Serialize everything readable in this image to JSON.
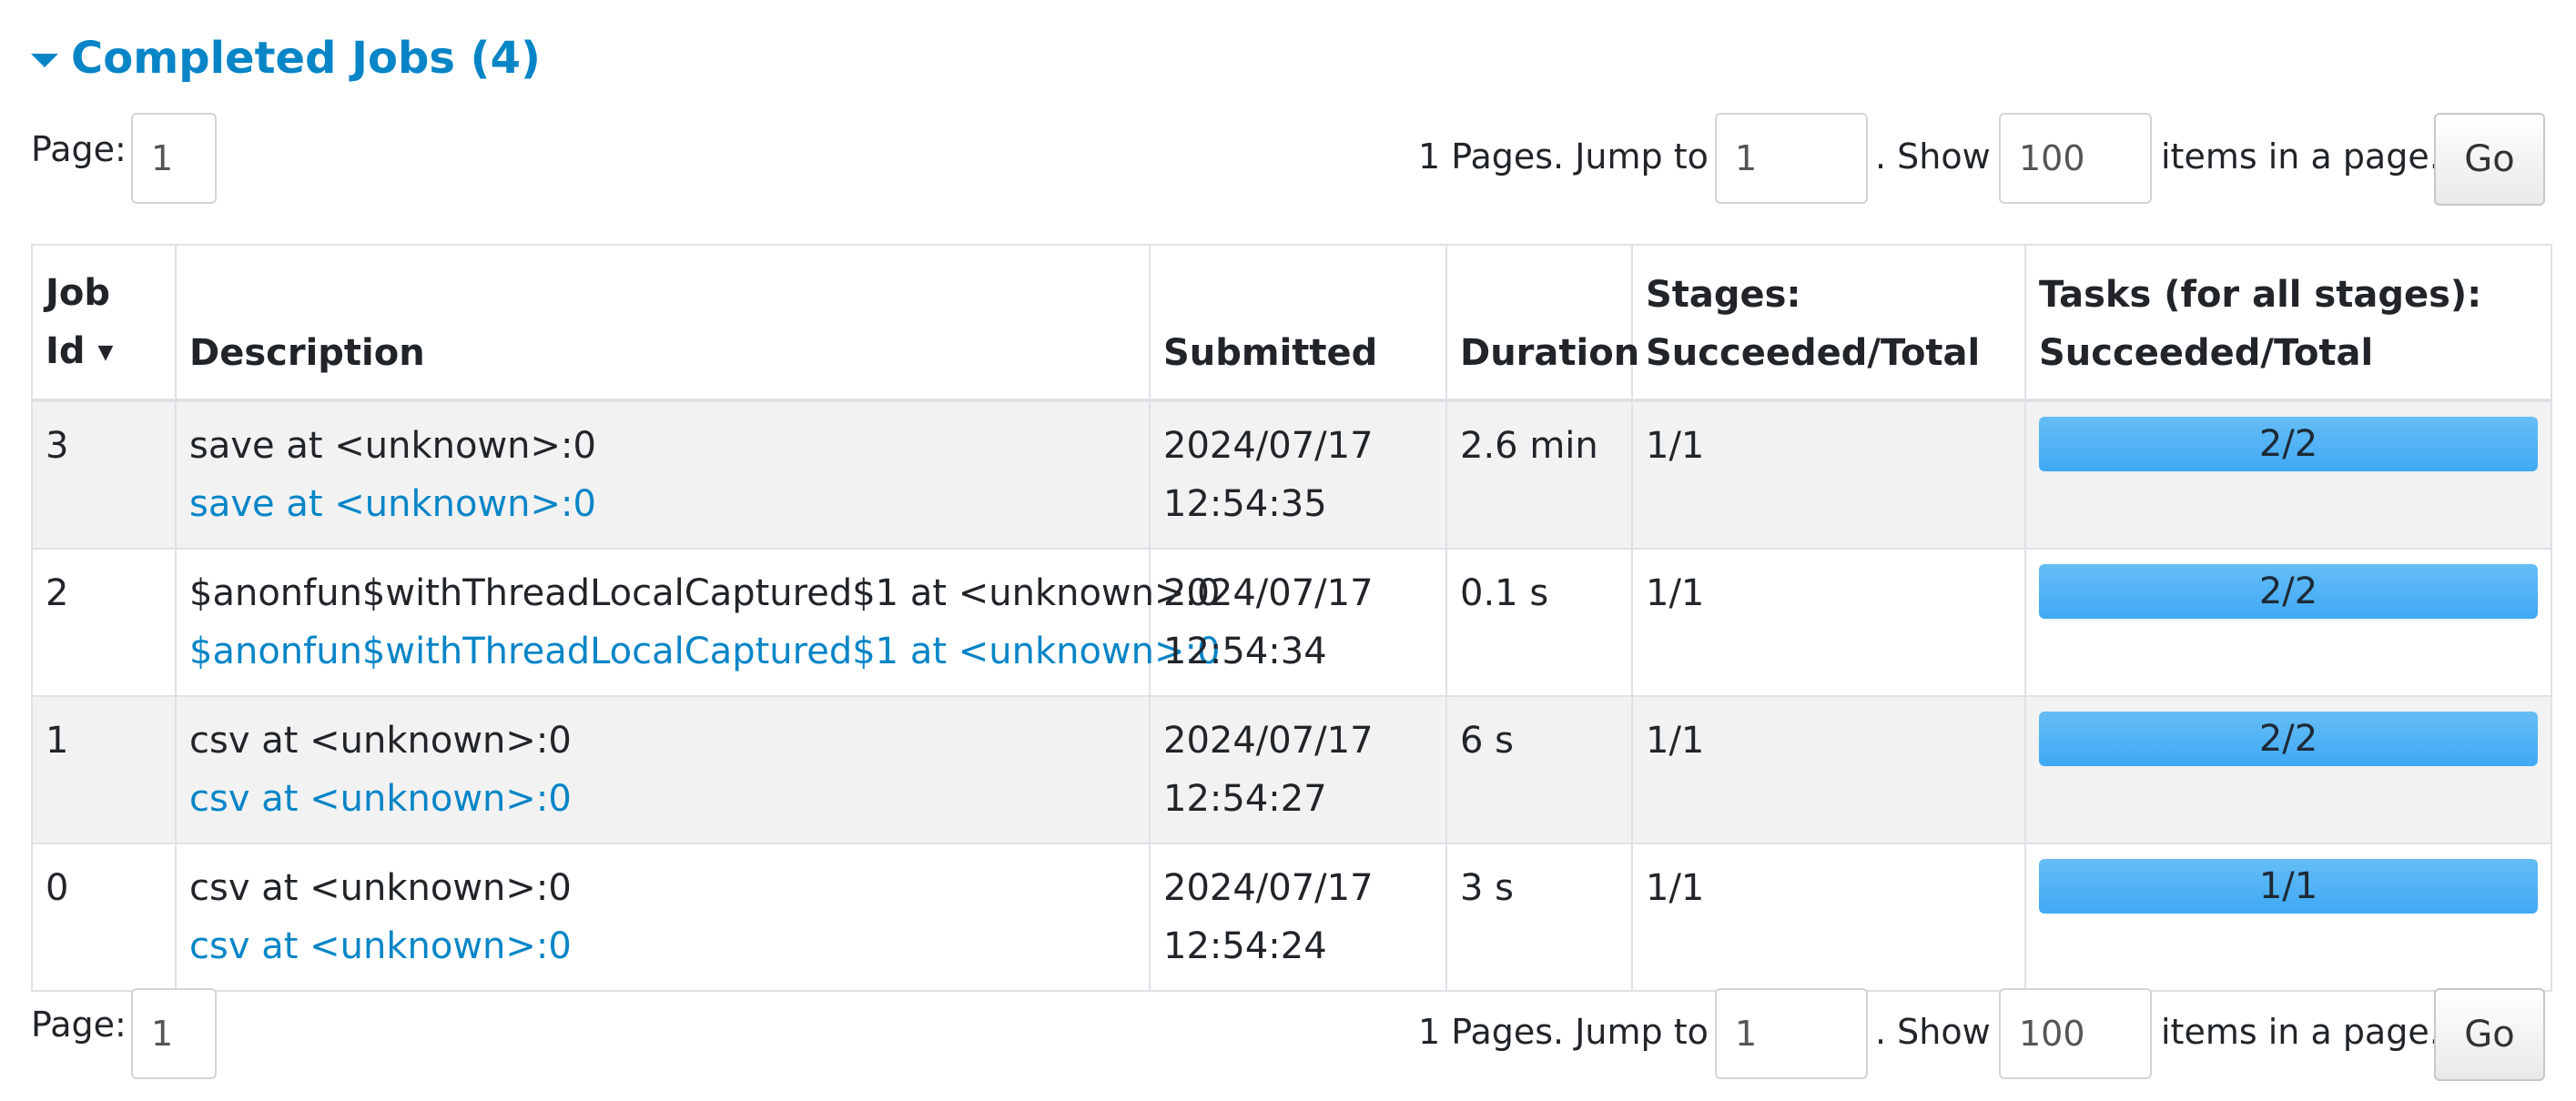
{
  "section": {
    "title": "Completed Jobs (4)"
  },
  "pagination": {
    "page_label": "Page:",
    "page_value": "1",
    "pages_text": "1 Pages. Jump to",
    "jump_value": "1",
    "show_text": ". Show",
    "show_value": "100",
    "items_text": "items in a page.",
    "go_label": "Go"
  },
  "table": {
    "headers": {
      "job_id_1": "Job",
      "job_id_2": "Id",
      "sort_icon": "▼",
      "description": "Description",
      "submitted": "Submitted",
      "duration": "Duration",
      "stages_1": "Stages:",
      "stages_2": "Succeeded/Total",
      "tasks_1": "Tasks (for all stages):",
      "tasks_2": "Succeeded/Total"
    },
    "rows": [
      {
        "job_id": "3",
        "description": "save at <unknown>:0",
        "link": "save at <unknown>:0",
        "date": "2024/07/17",
        "time": "12:54:35",
        "duration": "2.6 min",
        "stages": "1/1",
        "tasks": "2/2",
        "progress": 1.0
      },
      {
        "job_id": "2",
        "description": "$anonfun$withThreadLocalCaptured$1 at <unknown>:0",
        "link": "$anonfun$withThreadLocalCaptured$1 at <unknown>:0",
        "date": "2024/07/17",
        "time": "12:54:34",
        "duration": "0.1 s",
        "stages": "1/1",
        "tasks": "2/2",
        "progress": 1.0
      },
      {
        "job_id": "1",
        "description": "csv at <unknown>:0",
        "link": "csv at <unknown>:0",
        "date": "2024/07/17",
        "time": "12:54:27",
        "duration": "6 s",
        "stages": "1/1",
        "tasks": "2/2",
        "progress": 1.0
      },
      {
        "job_id": "0",
        "description": "csv at <unknown>:0",
        "link": "csv at <unknown>:0",
        "date": "2024/07/17",
        "time": "12:54:24",
        "duration": "3 s",
        "stages": "1/1",
        "tasks": "1/1",
        "progress": 1.0
      }
    ]
  },
  "colors": {
    "accent": "#0785c7",
    "progress_bar": "#3fa9f5"
  }
}
